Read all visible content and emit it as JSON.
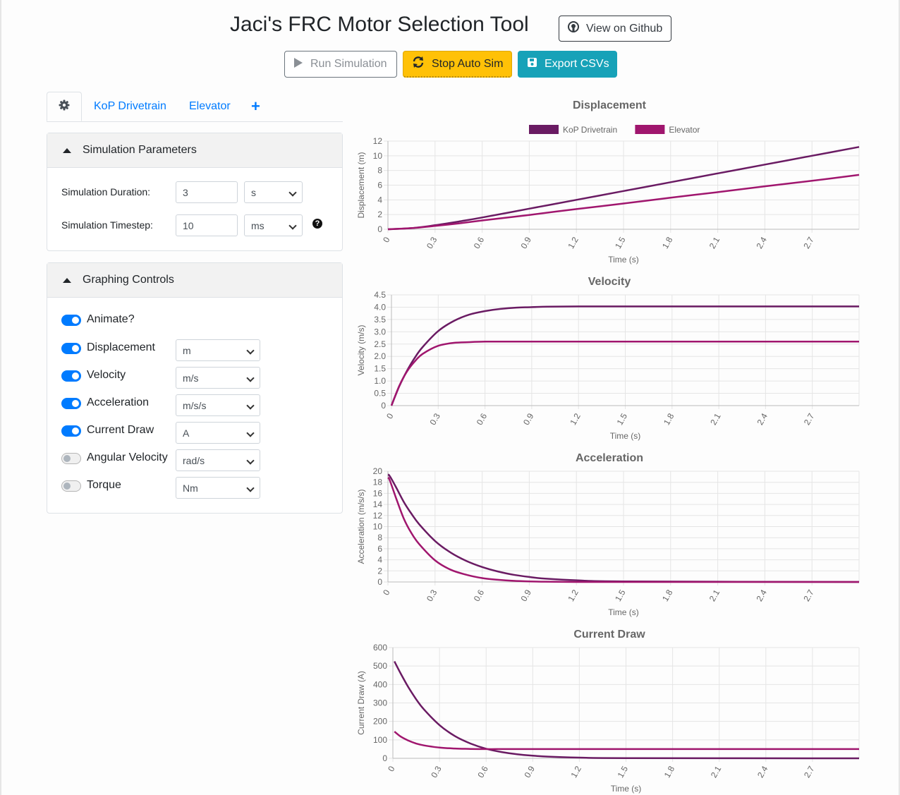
{
  "header": {
    "title": "Jaci's FRC Motor Selection Tool",
    "github_label": "View on Github"
  },
  "toolbar": {
    "run_label": "Run Simulation",
    "stop_label": "Stop Auto Sim",
    "export_label": "Export CSVs"
  },
  "tabs": [
    {
      "label": "KoP Drivetrain"
    },
    {
      "label": "Elevator"
    },
    {
      "label": "+"
    }
  ],
  "sim_params": {
    "title": "Simulation Parameters",
    "duration_label": "Simulation Duration:",
    "duration_value": "3",
    "duration_unit": "s",
    "timestep_label": "Simulation Timestep:",
    "timestep_value": "10",
    "timestep_unit": "ms"
  },
  "graphing": {
    "title": "Graphing Controls",
    "animate": {
      "label": "Animate?",
      "on": true
    },
    "items": [
      {
        "label": "Displacement",
        "unit": "m",
        "on": true
      },
      {
        "label": "Velocity",
        "unit": "m/s",
        "on": true
      },
      {
        "label": "Acceleration",
        "unit": "m/s/s",
        "on": true
      },
      {
        "label": "Current Draw",
        "unit": "A",
        "on": true
      },
      {
        "label": "Angular Velocity",
        "unit": "rad/s",
        "on": false
      },
      {
        "label": "Torque",
        "unit": "Nm",
        "on": false
      }
    ]
  },
  "colors": {
    "kop": "#6a1b63",
    "elevator": "#a0166e",
    "primary": "#007bff",
    "warning": "#ffc107",
    "info": "#17a2b8"
  },
  "chart_data": [
    {
      "type": "line",
      "title": "Displacement",
      "xlabel": "Time (s)",
      "ylabel": "Displacement (m)",
      "ylim": [
        0,
        12
      ],
      "yticks": [
        0,
        2,
        4,
        6,
        8,
        10,
        12
      ],
      "xlim": [
        0,
        3
      ],
      "xticks": [
        "0",
        "0.3",
        "0.6",
        "0.9",
        "1.2",
        "1.5",
        "1.8",
        "2.1",
        "2.4",
        "2.7"
      ],
      "legend": "top",
      "grid": true,
      "x": [
        0,
        0.15,
        0.3,
        0.45,
        0.6,
        0.9,
        1.2,
        1.5,
        1.8,
        2.1,
        2.4,
        2.7,
        3.0
      ],
      "series": [
        {
          "name": "KoP Drivetrain",
          "values": [
            0,
            0.15,
            0.55,
            1.05,
            1.6,
            2.8,
            4.0,
            5.2,
            6.4,
            7.6,
            8.8,
            10.0,
            11.2
          ]
        },
        {
          "name": "Elevator",
          "values": [
            0,
            0.15,
            0.45,
            0.8,
            1.2,
            1.95,
            2.75,
            3.5,
            4.3,
            5.05,
            5.85,
            6.6,
            7.4
          ]
        }
      ]
    },
    {
      "type": "line",
      "title": "Velocity",
      "xlabel": "Time (s)",
      "ylabel": "Velocity (m/s)",
      "ylim": [
        0,
        4.5
      ],
      "yticks": [
        0,
        0.5,
        1.0,
        1.5,
        2.0,
        2.5,
        3.0,
        3.5,
        4.0,
        4.5
      ],
      "xlim": [
        0,
        3
      ],
      "xticks": [
        "0",
        "0.3",
        "0.6",
        "0.9",
        "1.2",
        "1.5",
        "1.8",
        "2.1",
        "2.4",
        "2.7"
      ],
      "grid": true,
      "x": [
        0,
        0.05,
        0.1,
        0.15,
        0.2,
        0.3,
        0.4,
        0.5,
        0.6,
        0.7,
        0.8,
        0.9,
        1.0,
        1.2,
        1.5,
        3.0
      ],
      "series": [
        {
          "name": "KoP Drivetrain",
          "values": [
            0,
            0.78,
            1.42,
            1.95,
            2.38,
            3.03,
            3.44,
            3.7,
            3.84,
            3.93,
            3.98,
            4.0,
            4.02,
            4.03,
            4.03,
            4.03
          ]
        },
        {
          "name": "Elevator",
          "values": [
            0,
            0.8,
            1.39,
            1.8,
            2.1,
            2.43,
            2.55,
            2.58,
            2.6,
            2.6,
            2.6,
            2.6,
            2.6,
            2.6,
            2.6,
            2.6
          ]
        }
      ]
    },
    {
      "type": "line",
      "title": "Acceleration",
      "xlabel": "Time (s)",
      "ylabel": "Acceleration (m/s/s)",
      "ylim": [
        0,
        20
      ],
      "yticks": [
        0,
        2,
        4,
        6,
        8,
        10,
        12,
        14,
        16,
        18,
        20
      ],
      "xlim": [
        0,
        3
      ],
      "xticks": [
        "0",
        "0.3",
        "0.6",
        "0.9",
        "1.2",
        "1.5",
        "1.8",
        "2.1",
        "2.4",
        "2.7"
      ],
      "grid": true,
      "x": [
        0,
        0.01,
        0.05,
        0.1,
        0.15,
        0.2,
        0.3,
        0.4,
        0.5,
        0.6,
        0.7,
        0.8,
        0.9,
        1.0,
        1.2,
        1.5,
        3.0
      ],
      "series": [
        {
          "name": "KoP Drivetrain",
          "values": [
            19.3,
            19.2,
            17.2,
            14.5,
            12.3,
            10.4,
            7.4,
            5.3,
            3.8,
            2.7,
            1.9,
            1.3,
            0.9,
            0.6,
            0.3,
            0.1,
            0
          ]
        },
        {
          "name": "Elevator",
          "values": [
            18.8,
            18.5,
            15.3,
            11.5,
            8.8,
            6.8,
            3.9,
            2.2,
            1.3,
            0.7,
            0.4,
            0.2,
            0.1,
            0.05,
            0,
            0,
            0
          ]
        }
      ]
    },
    {
      "type": "line",
      "title": "Current Draw",
      "xlabel": "Time (s)",
      "ylabel": "Current Draw (A)",
      "ylim": [
        0,
        600
      ],
      "yticks": [
        0,
        100,
        200,
        300,
        400,
        500,
        600
      ],
      "xlim": [
        0,
        3
      ],
      "xticks": [
        "0",
        "0.3",
        "0.6",
        "0.9",
        "1.2",
        "1.5",
        "1.8",
        "2.1",
        "2.4",
        "2.7"
      ],
      "grid": true,
      "x": [
        0.01,
        0.05,
        0.1,
        0.15,
        0.2,
        0.3,
        0.4,
        0.5,
        0.6,
        0.7,
        0.8,
        0.9,
        1.0,
        1.2,
        1.5,
        3.0
      ],
      "series": [
        {
          "name": "KoP Drivetrain",
          "values": [
            525,
            460,
            385,
            320,
            265,
            180,
            120,
            80,
            52,
            34,
            22,
            14,
            9,
            4,
            1,
            0
          ]
        },
        {
          "name": "Elevator",
          "values": [
            145,
            118,
            96,
            80,
            70,
            58,
            53,
            51,
            50,
            50,
            50,
            50,
            50,
            50,
            50,
            50
          ]
        }
      ]
    }
  ]
}
